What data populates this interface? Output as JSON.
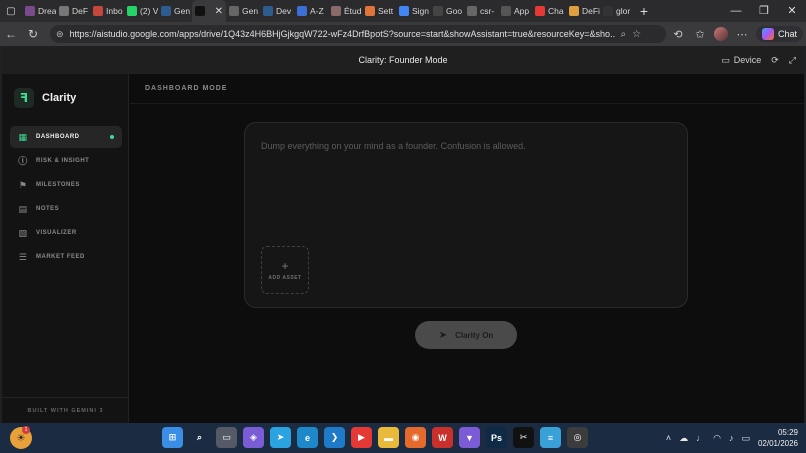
{
  "browser": {
    "tabs": [
      {
        "label": "Drea",
        "icon": "thread-icon",
        "color": "#7a4b8c"
      },
      {
        "label": "DeF",
        "icon": "circle-icon",
        "color": "#777777"
      },
      {
        "label": "Inbo",
        "icon": "gmail-icon",
        "color": "#c5463b"
      },
      {
        "label": "(2) V",
        "icon": "whatsapp-icon",
        "color": "#25d366"
      },
      {
        "label": "Gen",
        "icon": "d-icon",
        "color": "#2f5c8f"
      },
      {
        "label": "",
        "icon": "ai-studio-icon",
        "color": "#111111"
      },
      {
        "label": "Gen",
        "icon": "gear-icon",
        "color": "#666666"
      },
      {
        "label": "Dev",
        "icon": "d-icon",
        "color": "#2f5c8f"
      },
      {
        "label": "A-Z",
        "icon": "gemini-icon",
        "color": "#3b6fd6"
      },
      {
        "label": "Étud",
        "icon": "avatar-icon",
        "color": "#8a6a6a"
      },
      {
        "label": "Sett",
        "icon": "sun-icon",
        "color": "#e0743a"
      },
      {
        "label": "Sign",
        "icon": "google-icon",
        "color": "#4285f4"
      },
      {
        "label": "Goo",
        "icon": "box-icon",
        "color": "#444444"
      },
      {
        "label": "csr-",
        "icon": "link-icon",
        "color": "#666666"
      },
      {
        "label": "App",
        "icon": "grid-icon",
        "color": "#555555"
      },
      {
        "label": "Cha",
        "icon": "youtube-icon",
        "color": "#e53935"
      },
      {
        "label": "DeFi",
        "icon": "triangle-icon",
        "color": "#e0a040"
      },
      {
        "label": "glor",
        "icon": "github-icon",
        "color": "#333333"
      }
    ],
    "url": "https://aistudio.google.com/apps/drive/1Q43z4H6BHjGjkgqW722-wFz4DrfBpotS?source=start&showAssistant=true&resourceKey=&sho...",
    "chat_label": "Chat"
  },
  "app": {
    "window_title": "Clarity: Founder Mode",
    "device_label": "Device",
    "brand_name": "Clarity",
    "mode_label": "DASHBOARD MODE",
    "nav": [
      {
        "label": "DASHBOARD",
        "icon": "grid-icon",
        "glyph": "▦",
        "active": true
      },
      {
        "label": "RISK & INSIGHT",
        "icon": "alert-icon",
        "glyph": "ⓘ",
        "active": false
      },
      {
        "label": "MILESTONES",
        "icon": "flag-icon",
        "glyph": "⚑",
        "active": false
      },
      {
        "label": "NOTES",
        "icon": "file-icon",
        "glyph": "▤",
        "active": false
      },
      {
        "label": "VISUALIZER",
        "icon": "image-icon",
        "glyph": "▧",
        "active": false
      },
      {
        "label": "MARKET FEED",
        "icon": "list-icon",
        "glyph": "☰",
        "active": false
      }
    ],
    "footer": "BUILT WITH GEMINI 3",
    "input_placeholder": "Dump everything on your mind as a founder. Confusion is allowed.",
    "add_asset_label": "ADD ASSET",
    "submit_label": "Clarity On",
    "accent_color": "#3ddc97"
  },
  "taskbar": {
    "time": "05:29",
    "date": "02/01/2026",
    "badge_count": "1",
    "apps": [
      {
        "name": "windows-start-icon",
        "glyph": "⊞",
        "color": "#3a8ee6"
      },
      {
        "name": "search-icon",
        "glyph": "⌕",
        "color": "#1b2b42"
      },
      {
        "name": "task-view-icon",
        "glyph": "▭",
        "color": "#555a66"
      },
      {
        "name": "copilot-icon",
        "glyph": "◈",
        "color": "#7a5cd6"
      },
      {
        "name": "telegram-icon",
        "glyph": "➤",
        "color": "#2aa3e0"
      },
      {
        "name": "edge-icon",
        "glyph": "e",
        "color": "#1e88c8"
      },
      {
        "name": "vscode-icon",
        "glyph": "❯",
        "color": "#1f7ac9"
      },
      {
        "name": "youtube-icon",
        "glyph": "▶",
        "color": "#e53935"
      },
      {
        "name": "file-explorer-icon",
        "glyph": "▬",
        "color": "#e8b93a"
      },
      {
        "name": "firefox-icon",
        "glyph": "◉",
        "color": "#e66a2c"
      },
      {
        "name": "wps-icon",
        "glyph": "W",
        "color": "#c9302c"
      },
      {
        "name": "vpn-icon",
        "glyph": "▼",
        "color": "#7b5cd6"
      },
      {
        "name": "photoshop-icon",
        "glyph": "Ps",
        "color": "#0f2a45"
      },
      {
        "name": "capcut-icon",
        "glyph": "✂",
        "color": "#111111"
      },
      {
        "name": "notepad-icon",
        "glyph": "≡",
        "color": "#3aa0d8"
      },
      {
        "name": "chrome-icon",
        "glyph": "◎",
        "color": "#3c3c3c"
      }
    ]
  }
}
